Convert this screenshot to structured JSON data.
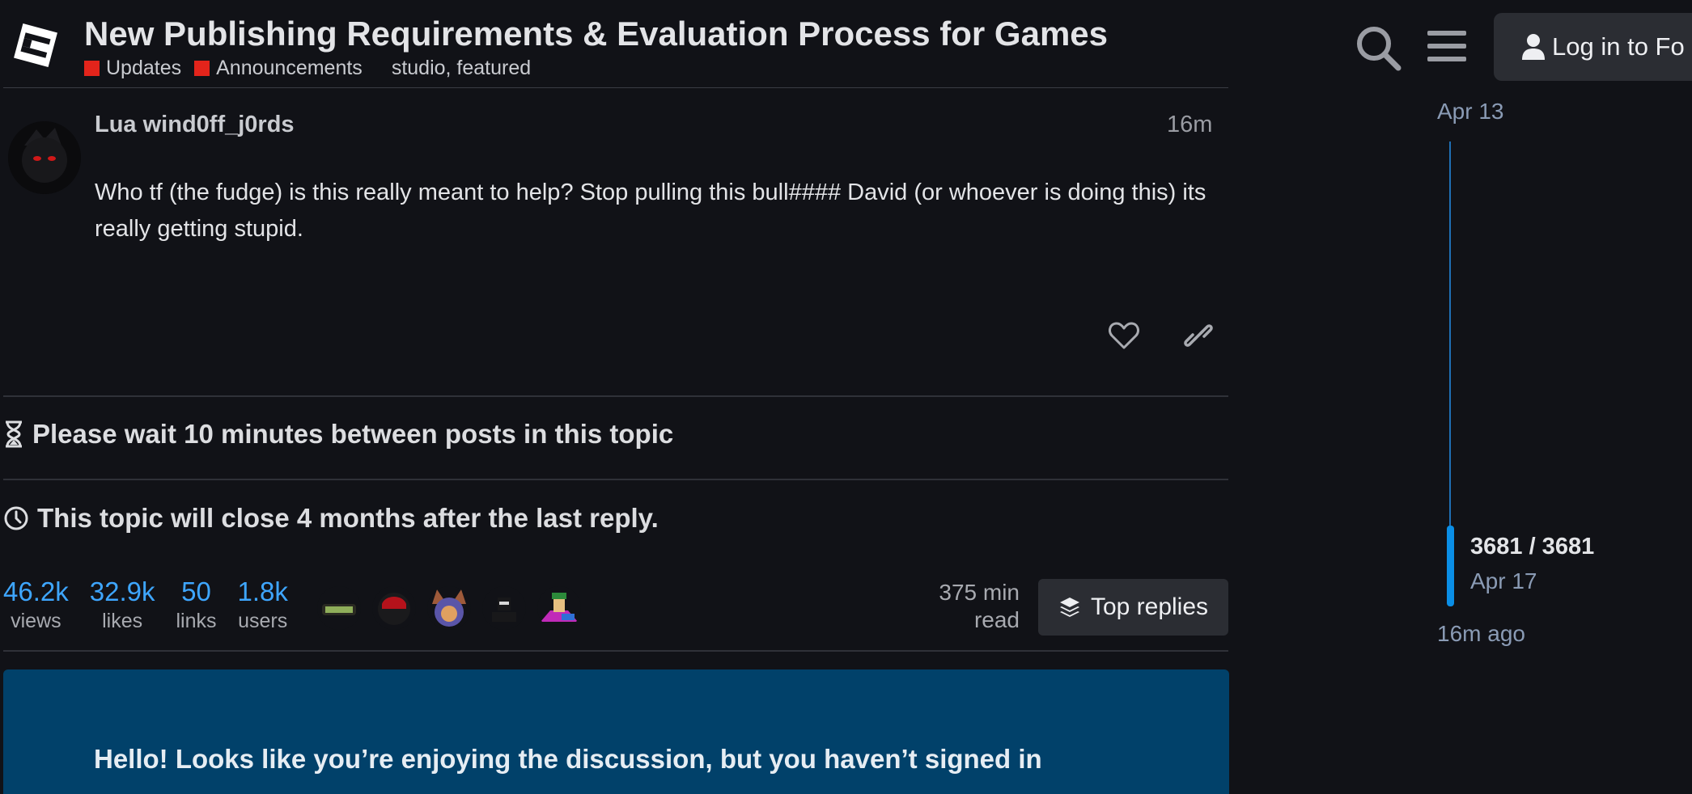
{
  "header": {
    "title": "New Publishing Requirements & Evaluation Process for Games",
    "categories": [
      {
        "label": "Updates",
        "color": "#e3241b"
      },
      {
        "label": "Announcements",
        "color": "#e3241b"
      }
    ],
    "tags": "studio, featured",
    "login_label": "Log in to Fo"
  },
  "post": {
    "username": "Lua wind0ff_j0rds",
    "time": "16m",
    "body": "Who tf (the fudge) is this really meant to help? Stop pulling this bull#### David (or whoever is doing this) its really getting stupid."
  },
  "notices": {
    "slow_mode": "Please wait 10 minutes between posts in this topic",
    "auto_close": "This topic will close 4 months after the last reply."
  },
  "stats": [
    {
      "value": "46.2k",
      "label": "views"
    },
    {
      "value": "32.9k",
      "label": "likes"
    },
    {
      "value": "50",
      "label": "links"
    },
    {
      "value": "1.8k",
      "label": "users"
    }
  ],
  "read_time": {
    "value": "375 min",
    "label": "read"
  },
  "top_replies_label": "Top replies",
  "banner": {
    "text": "Hello! Looks like you’re enjoying the discussion, but you haven’t signed in"
  },
  "timeline": {
    "start_date": "Apr 13",
    "position": "3681 / 3681",
    "end_date": "Apr 17",
    "last_activity": "16m ago"
  },
  "colors": {
    "background": "#111217",
    "accent": "#3ea6ff",
    "category": "#e3241b",
    "banner": "#01416a"
  }
}
